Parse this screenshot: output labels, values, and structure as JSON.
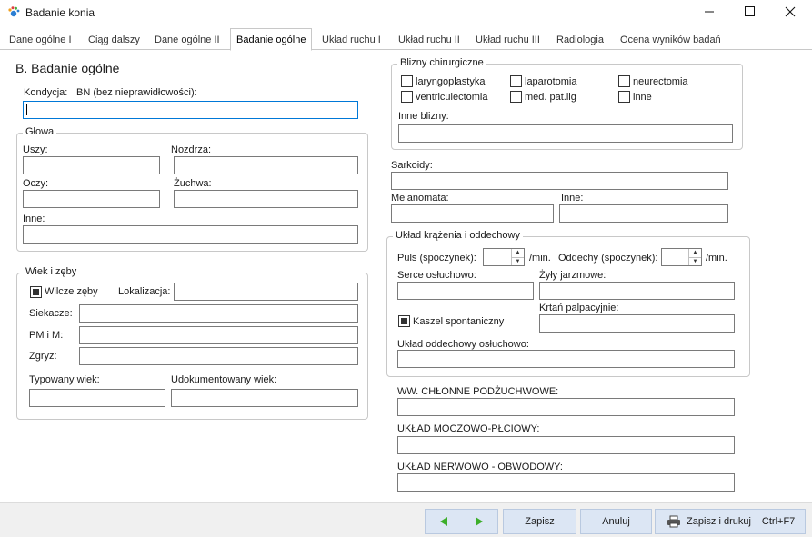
{
  "window": {
    "title": "Badanie konia",
    "icon": "paw-icon",
    "controls": [
      "minimize-icon",
      "maximize-icon",
      "close-icon"
    ]
  },
  "tabs": [
    {
      "label": "Dane ogólne I"
    },
    {
      "label": "Ciąg dalszy"
    },
    {
      "label": "Dane ogólne II"
    },
    {
      "label": "Badanie ogólne",
      "active": true
    },
    {
      "label": "Układ ruchu I"
    },
    {
      "label": "Układ ruchu II"
    },
    {
      "label": "Układ ruchu III"
    },
    {
      "label": "Radiologia"
    },
    {
      "label": "Ocena wyników badań"
    }
  ],
  "section_title": "B. Badanie ogólne",
  "kondycja": {
    "label": "Kondycja:",
    "hint": "BN (bez nieprawidłowości):",
    "value": ""
  },
  "glowa": {
    "title": "Głowa",
    "uszy": "Uszy:",
    "nozdrza": "Nozdrza:",
    "oczy": "Oczy:",
    "zuchwa": "Żuchwa:",
    "inne": "Inne:"
  },
  "wiek": {
    "title": "Wiek i zęby",
    "wilcze": {
      "label": "Wilcze zęby",
      "checked": true
    },
    "lokalizacja": "Lokalizacja:",
    "siekacze": "Siekacze:",
    "pm": "PM i M:",
    "zgryz": "Zgryz:",
    "typowany": "Typowany wiek:",
    "udokumentowany": "Udokumentowany wiek:"
  },
  "blizny": {
    "title": "Blizny chirurgiczne",
    "checks": [
      {
        "label": "laryngoplastyka",
        "checked": false
      },
      {
        "label": "laparotomia",
        "checked": false
      },
      {
        "label": "neurectomia",
        "checked": false
      },
      {
        "label": "ventriculectomia",
        "checked": false
      },
      {
        "label": "med. pat.lig",
        "checked": false
      },
      {
        "label": "inne",
        "checked": false
      }
    ],
    "inne_blizny": "Inne blizny:"
  },
  "sarkoidy": "Sarkoidy:",
  "melanomata": "Melanomata:",
  "inne_skora": "Inne:",
  "krazenie": {
    "title": "Układ krążenia i oddechowy",
    "puls": "Puls (spoczynek):",
    "puls_value": "",
    "puls_unit": "/min.",
    "oddechy": "Oddechy (spoczynek):",
    "oddechy_value": "",
    "oddechy_unit": "/min.",
    "serce": "Serce  osłuchowo:",
    "zyly": "Żyły  jarzmowe:",
    "krtan": "Krtań  palpacyjnie:",
    "kaszel": {
      "label": "Kaszel spontaniczny",
      "checked": true
    },
    "oddechowy": "Układ oddechowy  osłuchowo:"
  },
  "ww": "WW. CHŁONNE  PODŻUCHWOWE:",
  "moczowo": "UKŁAD  MOCZOWO-PŁCIOWY:",
  "nerwowo": "UKŁAD  NERWOWO - OBWODOWY:",
  "footer": {
    "prev_icon": "arrow-left-icon",
    "next_icon": "arrow-right-icon",
    "save": "Zapisz",
    "cancel": "Anuluj",
    "print_icon": "printer-icon",
    "save_print": "Zapisz i drukuj",
    "shortcut": "Ctrl+F7"
  },
  "colors": {
    "accent_green": "#3cae2a",
    "focus_border": "#0078d7",
    "footer_button": "#dce6f4"
  }
}
